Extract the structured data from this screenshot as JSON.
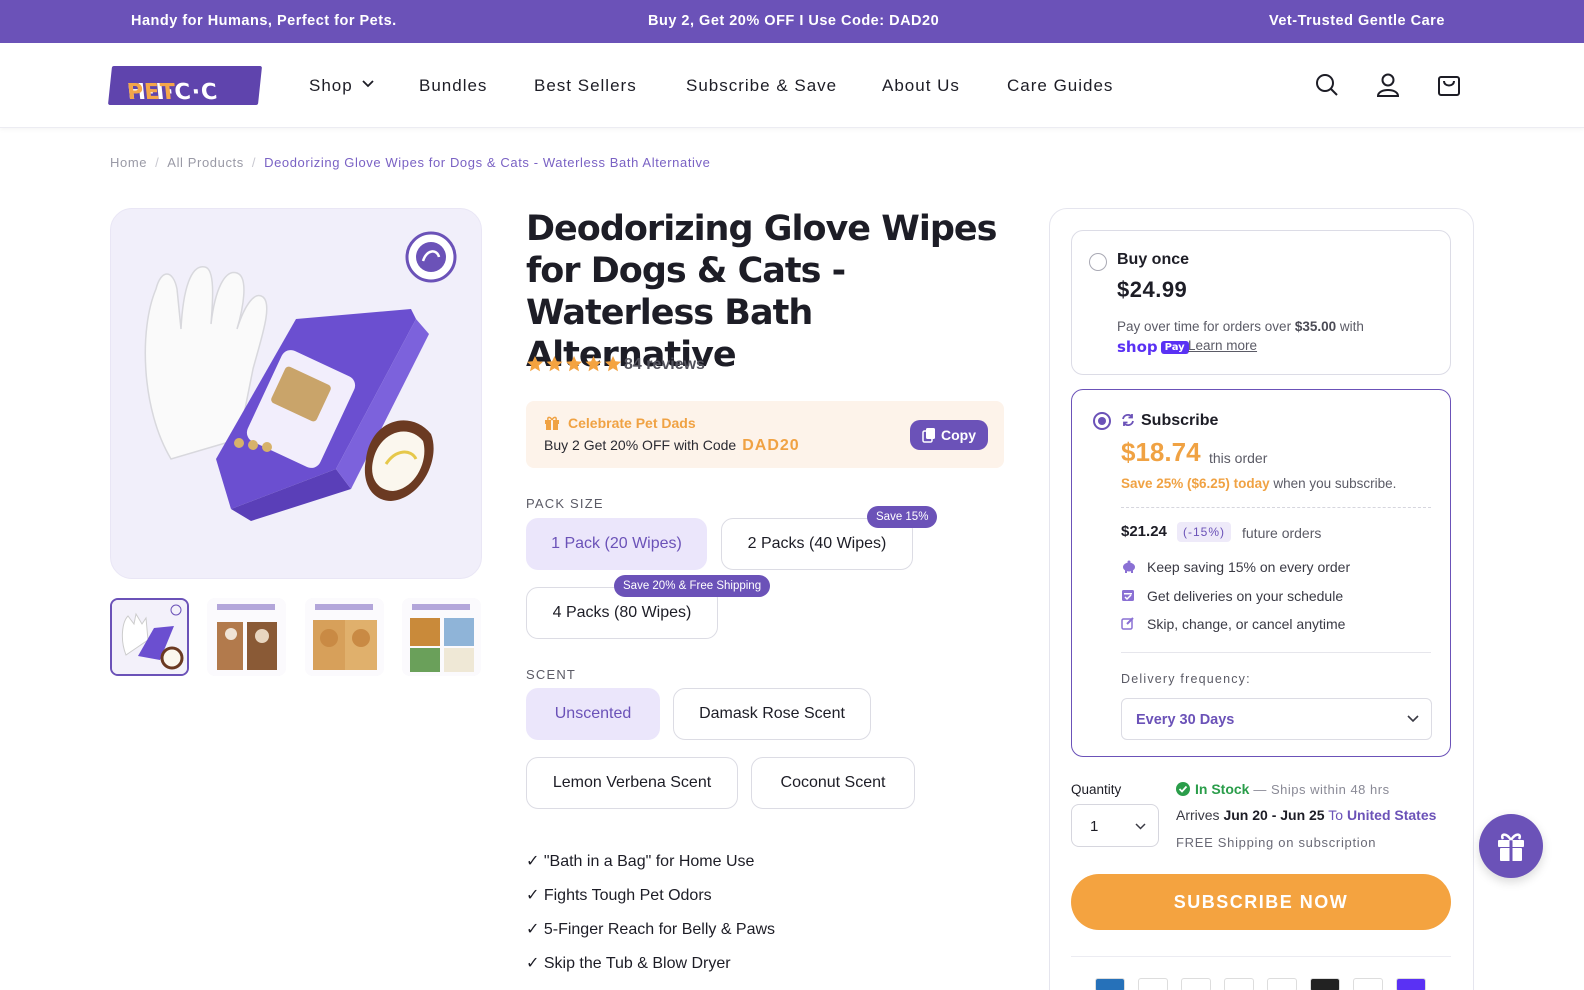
{
  "announcement": {
    "left": "Handy for Humans, Perfect for Pets.",
    "center": "Buy 2, Get 20% OFF I Use Code: DAD20",
    "right": "Vet-Trusted Gentle Care"
  },
  "header": {
    "logo_main": "H·I·C·C",
    "logo_accent": "PET",
    "nav": [
      "Shop",
      "Bundles",
      "Best Sellers",
      "Subscribe & Save",
      "About Us",
      "Care Guides"
    ],
    "icons": [
      "search-icon",
      "account-icon",
      "cart-icon"
    ]
  },
  "breadcrumb": {
    "home": "Home",
    "collection": "All Products",
    "current": "Deodorizing Glove Wipes for Dogs & Cats - Waterless Bath Alternative"
  },
  "product": {
    "title": "Deodorizing Glove Wipes for Dogs & Cats - Waterless Bath Alternative",
    "rating_stars": 5,
    "reviews": "84 reviews",
    "promo": {
      "title": "Celebrate Pet Dads",
      "line": "Buy 2 Get 20% OFF with Code",
      "code": "DAD20",
      "copy_label": "Copy"
    },
    "pack_size": {
      "label": "PACK SIZE",
      "options": [
        {
          "label": "1 Pack (20 Wipes)",
          "selected": true,
          "badge": ""
        },
        {
          "label": "2 Packs (40 Wipes)",
          "selected": false,
          "badge": "Save 15%"
        },
        {
          "label": "4 Packs (80 Wipes)",
          "selected": false,
          "badge": "Save 20% & Free Shipping"
        }
      ]
    },
    "scent": {
      "label": "SCENT",
      "options": [
        {
          "label": "Unscented",
          "selected": true
        },
        {
          "label": "Damask Rose Scent",
          "selected": false
        },
        {
          "label": "Lemon Verbena Scent",
          "selected": false
        },
        {
          "label": "Coconut Scent",
          "selected": false
        }
      ]
    },
    "bullets": [
      "✓ \"Bath in a Bag\" for Home Use",
      "✓ Fights Tough Pet Odors",
      "✓ 5-Finger Reach for Belly & Paws",
      "✓ Skip the Tub & Blow Dryer"
    ]
  },
  "purchase": {
    "buy_once": {
      "label": "Buy once",
      "price": "$24.99",
      "pay_over_time": "Pay over time for orders over",
      "threshold": "$35.00",
      "with": "with",
      "shop_pay": "shop",
      "shop_pay_badge": "Pay",
      "learn_more": "Learn more"
    },
    "subscribe": {
      "label": "Subscribe",
      "price": "$18.74",
      "this_order": "this order",
      "save_text": "Save 25% ($6.25) today",
      "save_suffix": "when you subscribe.",
      "future_price": "$21.24",
      "future_pct": "(-15%)",
      "future_label": "future orders",
      "perks": [
        "Keep saving 15% on every order",
        "Get deliveries on your schedule",
        "Skip, change, or cancel anytime"
      ],
      "frequency_label": "Delivery frequency:",
      "frequency_value": "Every 30 Days"
    },
    "quantity_label": "Quantity",
    "quantity_value": "1",
    "stock": "In Stock",
    "ships": "— Ships within 48 hrs",
    "arrives": "Arrives",
    "arrive_dates": "Jun 20 - Jun 25",
    "to": "To",
    "country": "United States",
    "free_shipping": "FREE Shipping on subscription",
    "cta": "SUBSCRIBE NOW"
  },
  "colors": {
    "brand": "#6b52b8",
    "accent": "#f4a340",
    "in_stock": "#2a9d4a"
  }
}
